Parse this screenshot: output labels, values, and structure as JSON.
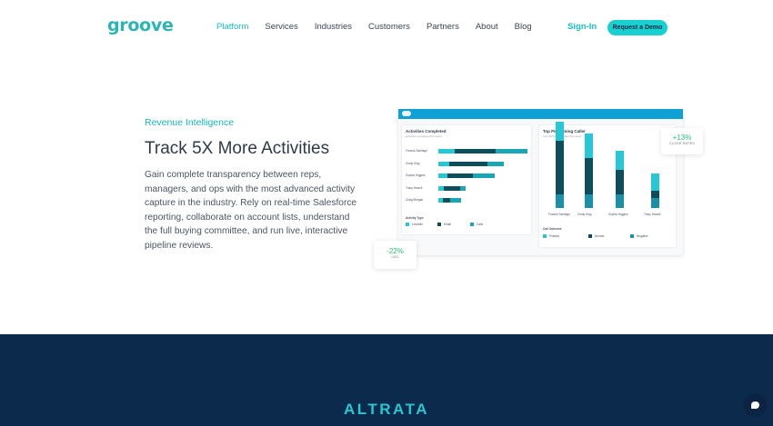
{
  "brand": {
    "logo_text": "groove",
    "accent": "#18c0c8",
    "navy": "#0c2a4c"
  },
  "nav": {
    "links": [
      "Platform",
      "Services",
      "Industries",
      "Customers",
      "Partners",
      "About",
      "Blog"
    ],
    "active": "Platform",
    "signin_label": "Sign-In",
    "demo_label": "Request a Demo"
  },
  "hero": {
    "eyebrow": "Revenue Intelligence",
    "headline": "Track 5X More Activities",
    "body": "Gain complete transparency between reps, managers, and ops with the most advanced activity capture in the industry. Rely on real-time Salesforce reporting, collaborate on account lists, understand the full buying committee, and run live, interactive pipeline reviews."
  },
  "dashboard": {
    "activities": {
      "title": "Activities Completed",
      "subtitle": "Activities completed this week",
      "rows": [
        {
          "name": "Francis Santiago",
          "linkedin": 0.18,
          "email": 0.45,
          "calls": 0.35
        },
        {
          "name": "Cindy King",
          "linkedin": 0.12,
          "email": 0.42,
          "calls": 0.18
        },
        {
          "name": "Sophia Higgins",
          "linkedin": 0.1,
          "email": 0.28,
          "calls": 0.24
        },
        {
          "name": "Tracy Howell",
          "linkedin": 0.06,
          "email": 0.18,
          "calls": 0.06
        },
        {
          "name": "Craig Morgan",
          "linkedin": 0.05,
          "email": 0.08,
          "calls": 0.12
        }
      ],
      "legend_title": "Activity Type",
      "legend": [
        "LinkedIn",
        "Email",
        "Calls"
      ]
    },
    "top_caller": {
      "title": "Top Performing Caller",
      "subtitle": "Top Performing Caller this week",
      "columns": [
        {
          "name": "Francis Santiago",
          "positive": 0.22,
          "neutral": 0.62,
          "negative": 0.16
        },
        {
          "name": "Cindy King",
          "positive": 0.28,
          "neutral": 0.42,
          "negative": 0.16
        },
        {
          "name": "Sophia Higgins",
          "positive": 0.22,
          "neutral": 0.28,
          "negative": 0.16
        },
        {
          "name": "Tracy Howell",
          "positive": 0.2,
          "neutral": 0.08,
          "negative": 0.12
        }
      ],
      "legend_title": "Call Outcome",
      "legend": [
        "Positive",
        "Neutral",
        "Negative"
      ]
    },
    "callout_close": {
      "value": "+13%",
      "label": "CLOSE RATES"
    },
    "callout_cac": {
      "value": "-22%",
      "label": "CAC"
    },
    "colors": {
      "linkedin": "#27c7d6",
      "email": "#0e4d5c",
      "calls": "#1aa7b4",
      "positive": "#27c7d6",
      "neutral": "#0e4d5c",
      "negative": "#1a8fa5"
    }
  },
  "band": {
    "logo_text": "ALTRATA"
  }
}
